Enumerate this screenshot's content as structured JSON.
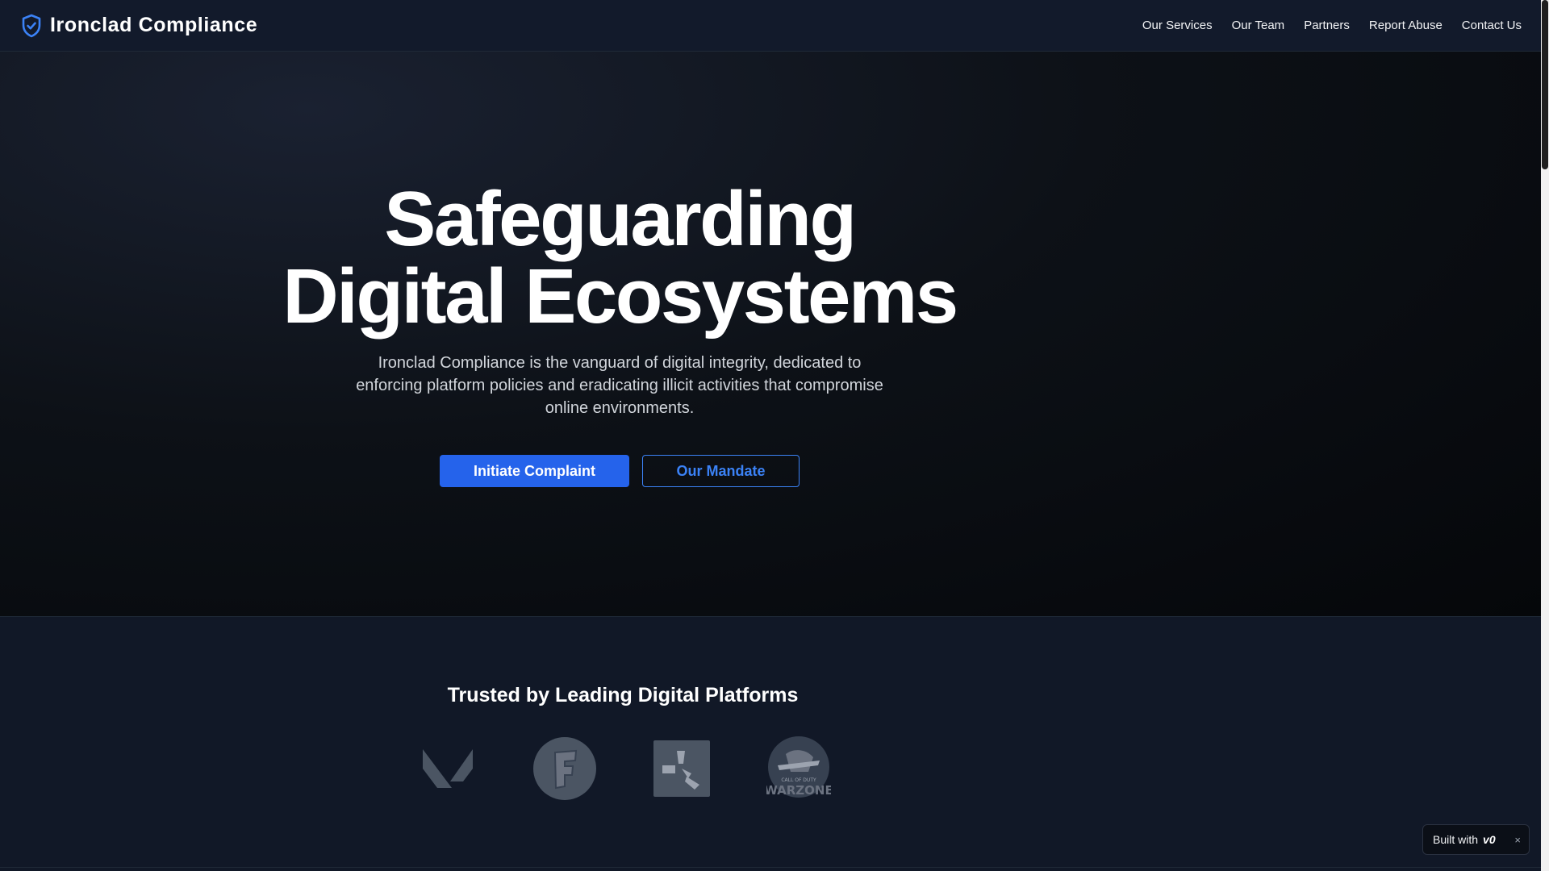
{
  "header": {
    "brand_name": "Ironclad Compliance",
    "brand_icon": "shield-check-icon",
    "nav": [
      {
        "label": "Our Services"
      },
      {
        "label": "Our Team"
      },
      {
        "label": "Partners"
      },
      {
        "label": "Report Abuse"
      },
      {
        "label": "Contact Us"
      }
    ]
  },
  "hero": {
    "title_line1": "Safeguarding",
    "title_line2": "Digital Ecosystems",
    "subtitle": "Ironclad Compliance is the vanguard of digital integrity, dedicated to enforcing platform policies and eradicating illicit activities that compromise online environments.",
    "primary_cta": "Initiate Complaint",
    "secondary_cta": "Our Mandate"
  },
  "trusted": {
    "title": "Trusted by Leading Digital Platforms",
    "logos": [
      {
        "icon": "valorant-logo-icon"
      },
      {
        "icon": "fortnite-logo-icon"
      },
      {
        "icon": "rust-logo-icon"
      },
      {
        "icon": "warzone-logo-icon",
        "caption_small": "CALL OF DUTY",
        "caption": "WARZONE"
      }
    ]
  },
  "badge": {
    "label": "Built with",
    "logo": "v0",
    "close": "×"
  },
  "colors": {
    "accent": "#2563eb",
    "accent_outline": "#3b82f6",
    "background": "#111827",
    "hero_dark": "#05070a"
  }
}
